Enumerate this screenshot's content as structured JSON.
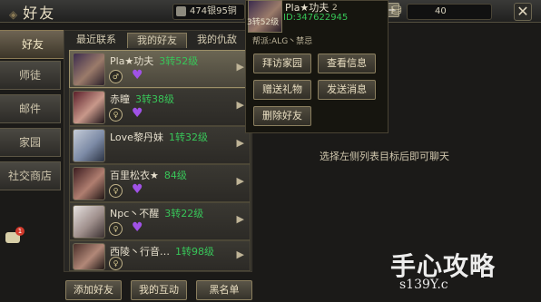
{
  "header": {
    "title": "好友",
    "currency_silver": "474银95铜",
    "currency_gold": "40"
  },
  "nav": {
    "items": [
      {
        "label": "好友"
      },
      {
        "label": "师徒"
      },
      {
        "label": "邮件"
      },
      {
        "label": "家园"
      },
      {
        "label": "社交商店"
      }
    ]
  },
  "tabs": [
    {
      "label": "最近联系"
    },
    {
      "label": "我的好友"
    },
    {
      "label": "我的仇敌"
    }
  ],
  "friends": [
    {
      "name": "Pla★功夫",
      "level": "3转52级",
      "gender": "♂"
    },
    {
      "name": "赤瞳",
      "level": "3转38级",
      "gender": "♀"
    },
    {
      "name": "Love黎丹妹",
      "level": "1转32级",
      "gender": ""
    },
    {
      "name": "百里松衣★",
      "level": "84级",
      "gender": "♀"
    },
    {
      "name": "Npc丶不醒",
      "level": "3转22级",
      "gender": "♀"
    },
    {
      "name": "西陵丶行音…",
      "level": "1转98级",
      "gender": "♀"
    }
  ],
  "bottom": {
    "add_friend": "添加好友",
    "my_interaction": "我的互动",
    "blacklist": "黑名单"
  },
  "popup": {
    "level": "3转52级",
    "name": "Pla★功夫",
    "gender_num": "2",
    "id": "ID:347622945",
    "guild": "帮派:ALG丶禁忌",
    "actions": {
      "visit_home": "拜访家园",
      "view_info": "查看信息",
      "send_gift": "赠送礼物",
      "send_message": "发送消息",
      "delete_friend": "删除好友"
    }
  },
  "hint": "选择左侧列表目标后即可聊天",
  "chat_badge": "1",
  "watermark": {
    "brand": "手心攻略",
    "site": "s139Y.c"
  },
  "colors": {
    "level_green": "#38c659",
    "heart_purple": "#a052e6",
    "gold_border": "#8a7e5e"
  }
}
